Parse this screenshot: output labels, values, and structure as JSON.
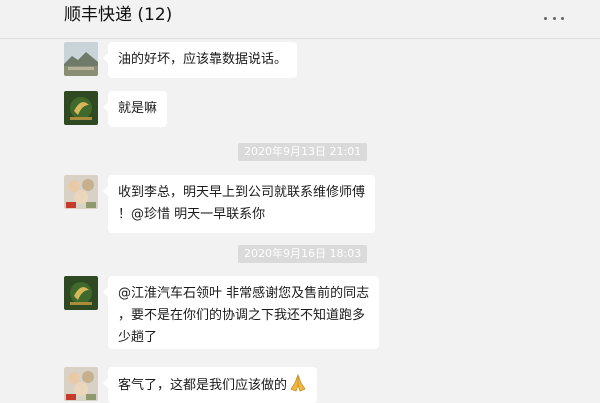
{
  "chat": {
    "title": "顺丰快递 (12)",
    "messages": [
      {
        "text": "油的好坏，应该靠数据说话。"
      },
      {
        "text": "就是嘛"
      },
      {
        "text_line1": "收到李总，明天早上到公司就联系维修师傅",
        "text_line2": "！@珍惜 明天一早联系你"
      },
      {
        "text_line1": "@江淮汽车石领叶 非常感谢您及售前的同志",
        "text_line2": "，要不是在你们的协调之下我还不知道跑多",
        "text_line3": "少趟了"
      },
      {
        "text": "客气了，这都是我们应该做的",
        "emoji": "folded-hands-icon"
      }
    ],
    "timestamps": [
      "2020年9月13日 21:01",
      "2020年9月16日 18:03"
    ]
  },
  "colors": {
    "background": "#f2f2f2",
    "bubble": "#ffffff",
    "timestamp_bg": "#dadada",
    "timestamp_text": "#ffffff"
  }
}
